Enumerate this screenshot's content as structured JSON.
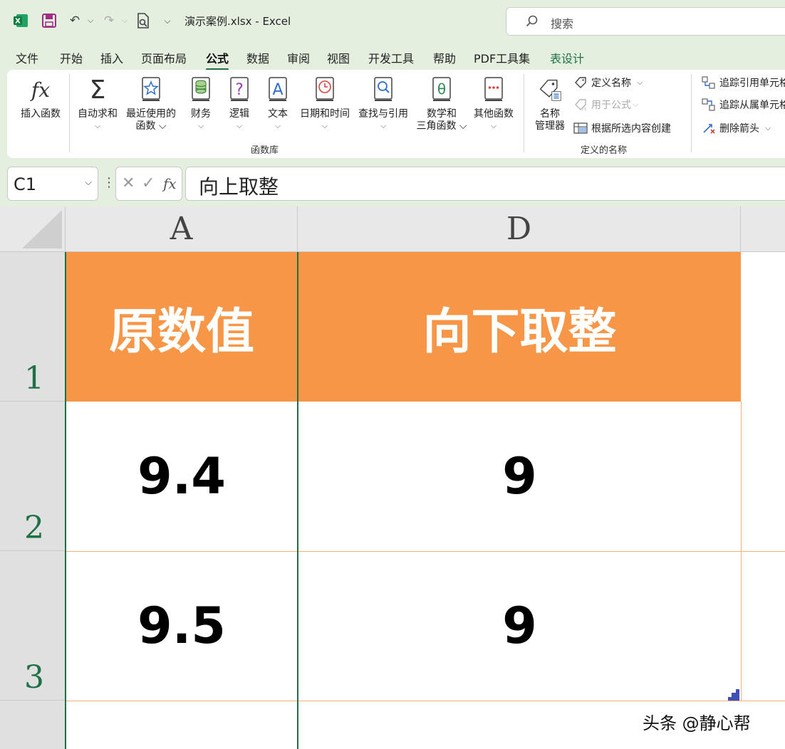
{
  "titlebar": {
    "doc_title": "演示案例.xlsx  -  Excel",
    "search_placeholder": "搜索"
  },
  "menu": {
    "tabs": [
      "文件",
      "开始",
      "插入",
      "页面布局",
      "公式",
      "数据",
      "审阅",
      "视图",
      "开发工具",
      "帮助",
      "PDF工具集",
      "表设计"
    ],
    "active": "公式"
  },
  "ribbon": {
    "function_library": {
      "insert_function": "插入函数",
      "autosum": "自动求和",
      "recent_line1": "最近使用的",
      "recent_line2": "函数",
      "financial": "财务",
      "logical": "逻辑",
      "text": "文本",
      "datetime": "日期和时间",
      "lookup": "查找与引用",
      "math_line1": "数学和",
      "math_line2": "三角函数",
      "more": "其他函数",
      "group_label": "函数库"
    },
    "defined_names": {
      "name_manager_line1": "名称",
      "name_manager_line2": "管理器",
      "define_name": "定义名称",
      "use_in_formula": "用于公式",
      "create_from_selection": "根据所选内容创建",
      "group_label": "定义的名称"
    },
    "auditing": {
      "trace_precedents": "追踪引用单元格",
      "trace_dependents": "追踪从属单元格",
      "remove_arrows": "删除箭头"
    }
  },
  "formula_bar": {
    "name_box": "C1",
    "fx_label": "fx",
    "content": "向上取整"
  },
  "sheet": {
    "columns": [
      "A",
      "D"
    ],
    "rows": [
      "1",
      "2",
      "3"
    ],
    "cells": {
      "a1": "原数值",
      "d1": "向下取整",
      "a2": "9.4",
      "d2": "9",
      "a3": "9.5",
      "d3": "9"
    },
    "header_fill": "#F79646",
    "header_text_color": "#FFFFFF",
    "accent_green": "#1E7145"
  },
  "watermark": "头条 @静心帮"
}
